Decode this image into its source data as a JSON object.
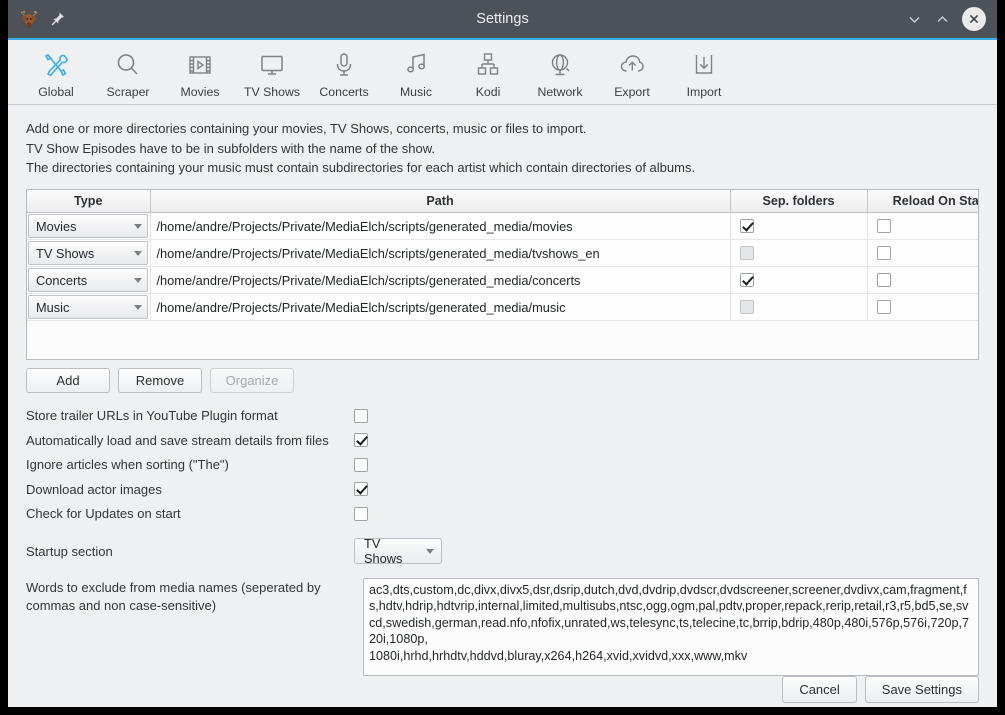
{
  "window": {
    "title": "Settings",
    "app_icon": "moose-head-icon",
    "pin_icon": "pin-icon",
    "controls": {
      "minimize": "chevron-down-icon",
      "maximize": "chevron-up-icon",
      "close": "close-icon"
    },
    "accent_color": "#3daee9",
    "titlebar_color": "#4d5158"
  },
  "toolbar": {
    "items": [
      {
        "label": "Global",
        "icon": "tools-icon",
        "active": true
      },
      {
        "label": "Scraper",
        "icon": "search-icon",
        "active": false
      },
      {
        "label": "Movies",
        "icon": "film-icon",
        "active": false
      },
      {
        "label": "TV Shows",
        "icon": "monitor-icon",
        "active": false
      },
      {
        "label": "Concerts",
        "icon": "microphone-icon",
        "active": false
      },
      {
        "label": "Music",
        "icon": "music-note-icon",
        "active": false
      },
      {
        "label": "Kodi",
        "icon": "network-tree-icon",
        "active": false
      },
      {
        "label": "Network",
        "icon": "globe-icon",
        "active": false
      },
      {
        "label": "Export",
        "icon": "cloud-upload-icon",
        "active": false
      },
      {
        "label": "Import",
        "icon": "download-box-icon",
        "active": false
      }
    ]
  },
  "description": [
    "Add one or more directories containing your movies, TV Shows, concerts, music or files to import.",
    "TV Show Episodes have to be in subfolders with the name of the show.",
    "The directories containing your music must contain subdirectories for each artist which contain directories of albums."
  ],
  "directories_table": {
    "columns": [
      "Type",
      "Path",
      "Sep. folders",
      "Reload On Start"
    ],
    "rows": [
      {
        "type": "Movies",
        "path": "/home/andre/Projects/Private/MediaElch/scripts/generated_media/movies",
        "sep_folders": true,
        "sep_folders_enabled": true,
        "reload_on_start": false
      },
      {
        "type": "TV Shows",
        "path": "/home/andre/Projects/Private/MediaElch/scripts/generated_media/tvshows_en",
        "sep_folders": false,
        "sep_folders_enabled": false,
        "reload_on_start": false
      },
      {
        "type": "Concerts",
        "path": "/home/andre/Projects/Private/MediaElch/scripts/generated_media/concerts",
        "sep_folders": true,
        "sep_folders_enabled": true,
        "reload_on_start": false
      },
      {
        "type": "Music",
        "path": "/home/andre/Projects/Private/MediaElch/scripts/generated_media/music",
        "sep_folders": false,
        "sep_folders_enabled": false,
        "reload_on_start": false
      }
    ]
  },
  "table_buttons": {
    "add": "Add",
    "remove": "Remove",
    "organize": "Organize",
    "organize_enabled": false
  },
  "options": [
    {
      "label": "Store trailer URLs in YouTube Plugin format",
      "checked": false,
      "name": "store-trailer-urls"
    },
    {
      "label": "Automatically load and save stream details from files",
      "checked": true,
      "name": "auto-stream-details"
    },
    {
      "label": "Ignore articles when sorting (\"The\")",
      "checked": false,
      "name": "ignore-articles"
    },
    {
      "label": "Download actor images",
      "checked": true,
      "name": "download-actor-images"
    },
    {
      "label": "Check for Updates on start",
      "checked": false,
      "name": "check-updates"
    }
  ],
  "startup": {
    "label": "Startup section",
    "value": "TV Shows"
  },
  "exclude_words": {
    "label": "Words to exclude from media names (seperated by commas and non case-sensitive)",
    "value": "ac3,dts,custom,dc,divx,divx5,dsr,dsrip,dutch,dvd,dvdrip,dvdscr,dvdscreener,screener,dvdivx,cam,fragment,fs,hdtv,hdrip,hdtvrip,internal,limited,multisubs,ntsc,ogg,ogm,pal,pdtv,proper,repack,rerip,retail,r3,r5,bd5,se,svcd,swedish,german,read.nfo,nfofix,unrated,ws,telesync,ts,telecine,tc,brrip,bdrip,480p,480i,576p,576i,720p,720i,1080p,\n1080i,hrhd,hrhdtv,hddvd,bluray,x264,h264,xvid,xvidvd,xxx,www,mkv"
  },
  "footer": {
    "cancel": "Cancel",
    "save": "Save Settings"
  }
}
